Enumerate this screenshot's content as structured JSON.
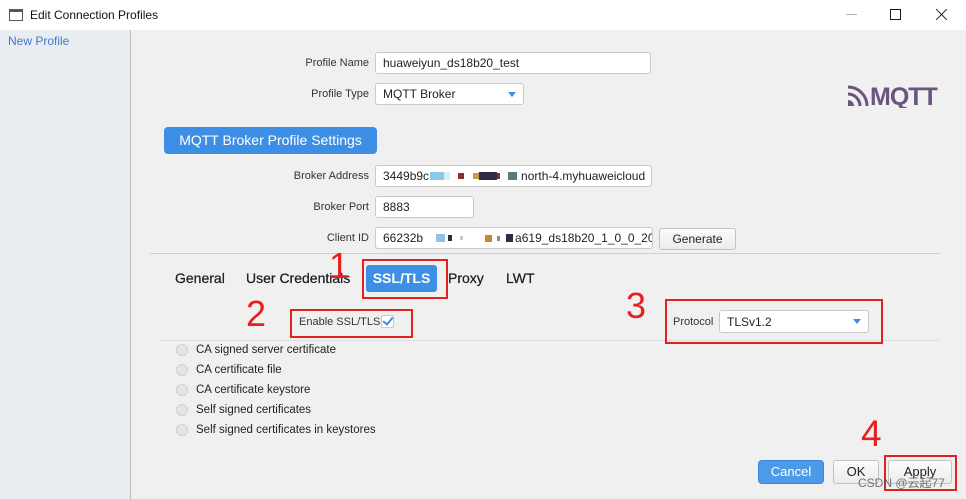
{
  "window": {
    "title": "Edit Connection Profiles",
    "icons": [
      "window-app-icon",
      "minimize-icon",
      "maximize-icon",
      "close-icon"
    ]
  },
  "sidebar": {
    "items": [
      {
        "label": "New Profile"
      }
    ]
  },
  "profile": {
    "name_label": "Profile Name",
    "name_value": "huaweiyun_ds18b20_test",
    "type_label": "Profile Type",
    "type_value": "MQTT Broker"
  },
  "logo": {
    "text": "MQTT"
  },
  "settings_header": "MQTT Broker Profile Settings",
  "broker": {
    "address_label": "Broker Address",
    "address_value_start": "3449b9c",
    "address_value_end": "north-4.myhuaweicloud",
    "port_label": "Broker Port",
    "port_value": "8883",
    "client_id_label": "Client ID",
    "client_id_value_start": "66232b",
    "client_id_value_end": "a619_ds18b20_1_0_0_20",
    "generate_label": "Generate"
  },
  "tabs": [
    {
      "label": "General",
      "selected": false
    },
    {
      "label": "User Credentials",
      "selected": false
    },
    {
      "label": "SSL/TLS",
      "selected": true
    },
    {
      "label": "Proxy",
      "selected": false
    },
    {
      "label": "LWT",
      "selected": false
    }
  ],
  "ssl": {
    "enable_label": "Enable SSL/TLS",
    "enabled": true,
    "protocol_label": "Protocol",
    "protocol_value": "TLSv1.2",
    "certificate_options": [
      {
        "label": "CA signed server certificate",
        "selected": false
      },
      {
        "label": "CA certificate file",
        "selected": false
      },
      {
        "label": "CA certificate keystore",
        "selected": false
      },
      {
        "label": "Self signed certificates",
        "selected": false
      },
      {
        "label": "Self signed certificates in keystores",
        "selected": false
      }
    ]
  },
  "annotations": {
    "step1": "1",
    "step2": "2",
    "step3": "3",
    "step4": "4"
  },
  "footer": {
    "cancel_label": "Cancel",
    "ok_label": "OK",
    "apply_label": "Apply"
  },
  "watermark": "CSDN @云起77",
  "colors": {
    "accent": "#3d8fe6",
    "annotation_red": "#e3211e",
    "link": "#3c7dc8",
    "logo": "#6a5580"
  }
}
